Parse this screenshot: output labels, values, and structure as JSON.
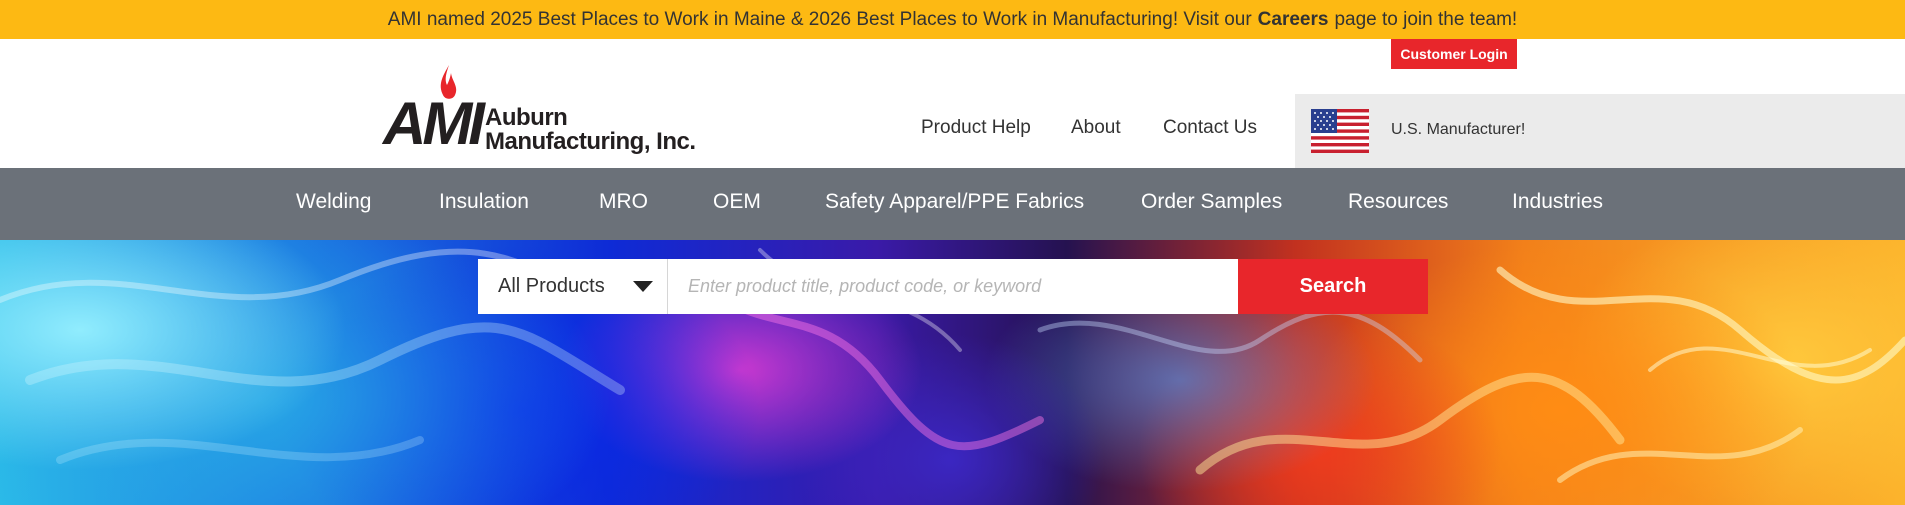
{
  "announcement": {
    "pre": "AMI named 2025 Best Places to Work in Maine & 2026 Best Places to Work in Manufacturing! Visit our",
    "link": "Careers",
    "post": "page to join the team!"
  },
  "header": {
    "logo": {
      "mark": "AMI",
      "line1": "Auburn",
      "line2": "Manufacturing, Inc."
    },
    "login_label": "Customer Login",
    "util_nav": [
      "Product Help",
      "About",
      "Contact Us"
    ],
    "usa_text": "U.S. Manufacturer!"
  },
  "main_nav": [
    "Welding",
    "Insulation",
    "MRO",
    "OEM",
    "Safety Apparel/PPE Fabrics",
    "Order Samples",
    "Resources",
    "Industries"
  ],
  "search": {
    "category": "All Products",
    "placeholder": "Enter product title, product code, or keyword",
    "button_label": "Search"
  },
  "colors": {
    "announcement_bg": "#fdb913",
    "nav_bg": "#6b7179",
    "accent_red": "#e8262b",
    "usa_box_bg": "#ebebeb"
  }
}
